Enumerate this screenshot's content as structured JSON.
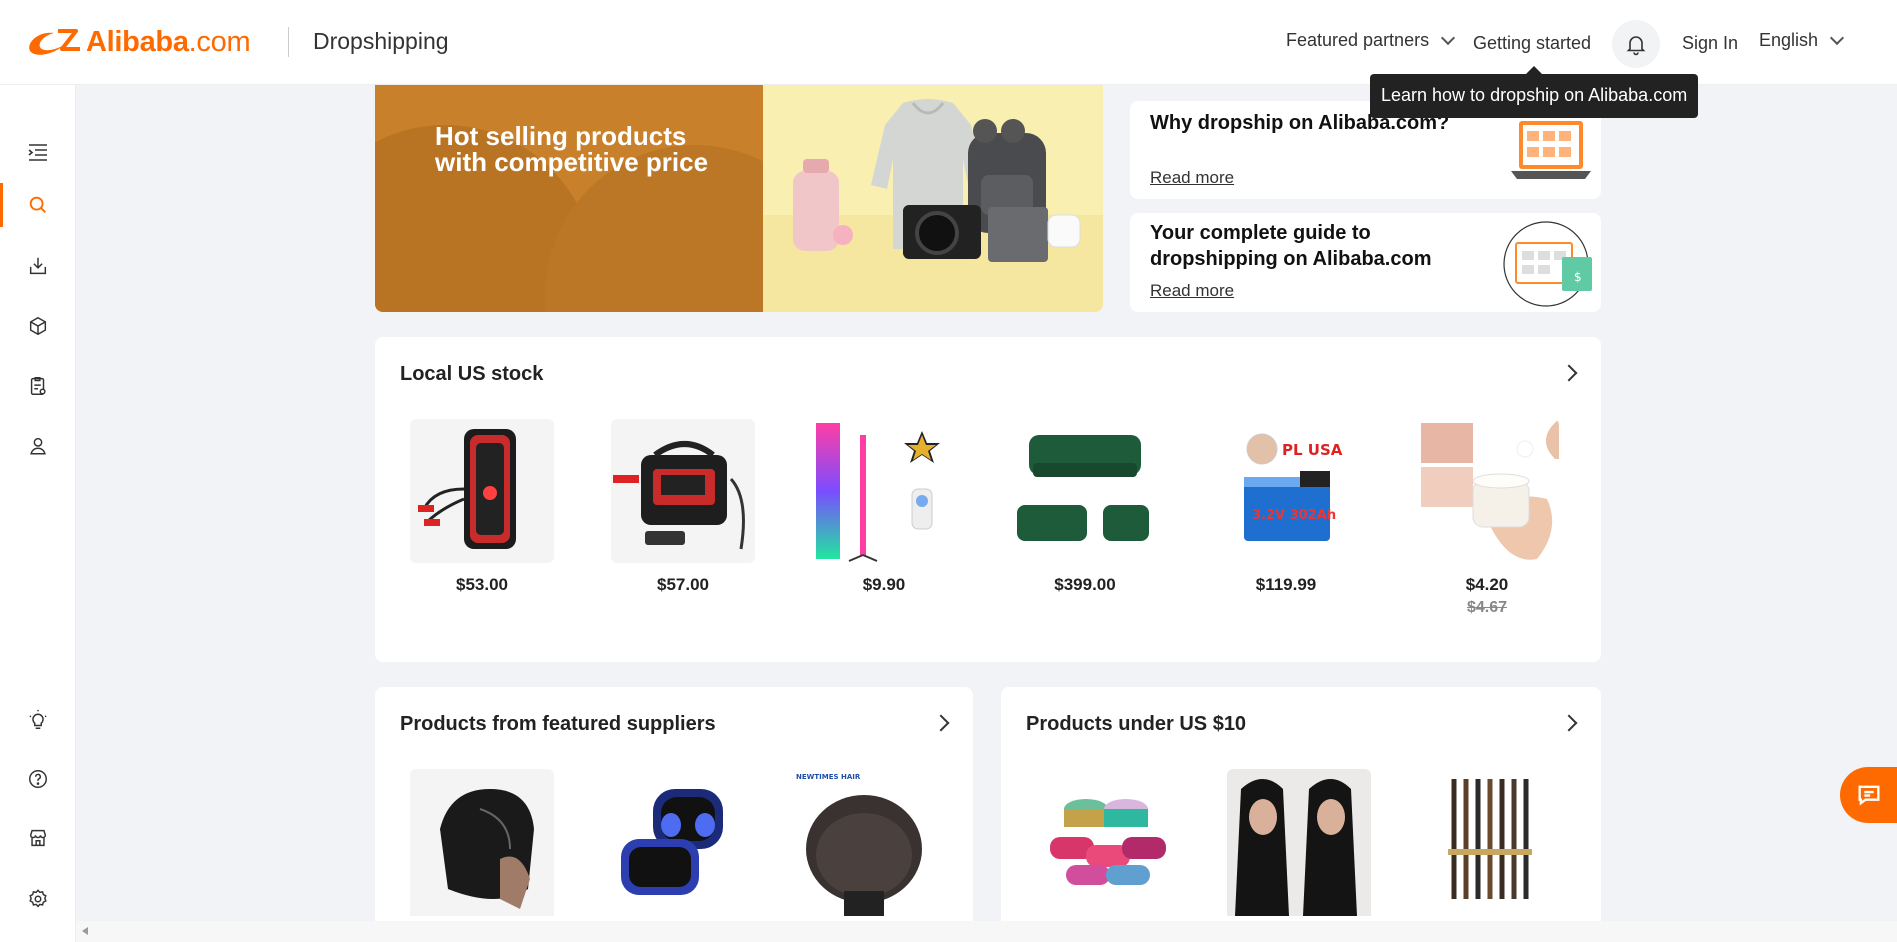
{
  "header": {
    "logo_text": "Alibaba",
    "logo_dotcom": ".com",
    "subtitle": "Dropshipping",
    "nav": {
      "featured_partners": "Featured partners",
      "getting_started": "Getting started",
      "sign_in": "Sign In",
      "language": "English"
    },
    "tooltip": "Learn how to dropship on Alibaba.com"
  },
  "sidebar": {
    "icons": [
      "menu-expand-icon",
      "search-icon",
      "download-icon",
      "box-icon",
      "clipboard-icon",
      "user-icon",
      "lightbulb-icon",
      "help-icon",
      "store-icon",
      "settings-icon"
    ],
    "active": "search-icon"
  },
  "banner": {
    "line1": "Hot selling products",
    "line2": "with competitive price"
  },
  "guides": [
    {
      "title": "Why dropship on Alibaba.com?",
      "link": "Read more"
    },
    {
      "title_line1": "Your complete guide to",
      "title_line2": "dropshipping on Alibaba.com",
      "link": "Read more"
    }
  ],
  "local_us_stock": {
    "title": "Local US stock",
    "products": [
      {
        "name": "jump-starter",
        "price": "$53.00"
      },
      {
        "name": "portable-power-station",
        "price": "$57.00"
      },
      {
        "name": "rgb-corner-lamp",
        "price": "$9.90"
      },
      {
        "name": "green-sofa-set",
        "price": "$399.00"
      },
      {
        "name": "lifepo4-battery",
        "price": "$119.99"
      },
      {
        "name": "face-cream",
        "price": "$4.20",
        "old_price": "$4.67"
      }
    ]
  },
  "featured_suppliers": {
    "title": "Products from featured suppliers"
  },
  "under_10": {
    "title": "Products under US $10"
  },
  "colors": {
    "accent": "#ff6a00",
    "background": "#f2f3f7",
    "tooltip": "#222222"
  }
}
